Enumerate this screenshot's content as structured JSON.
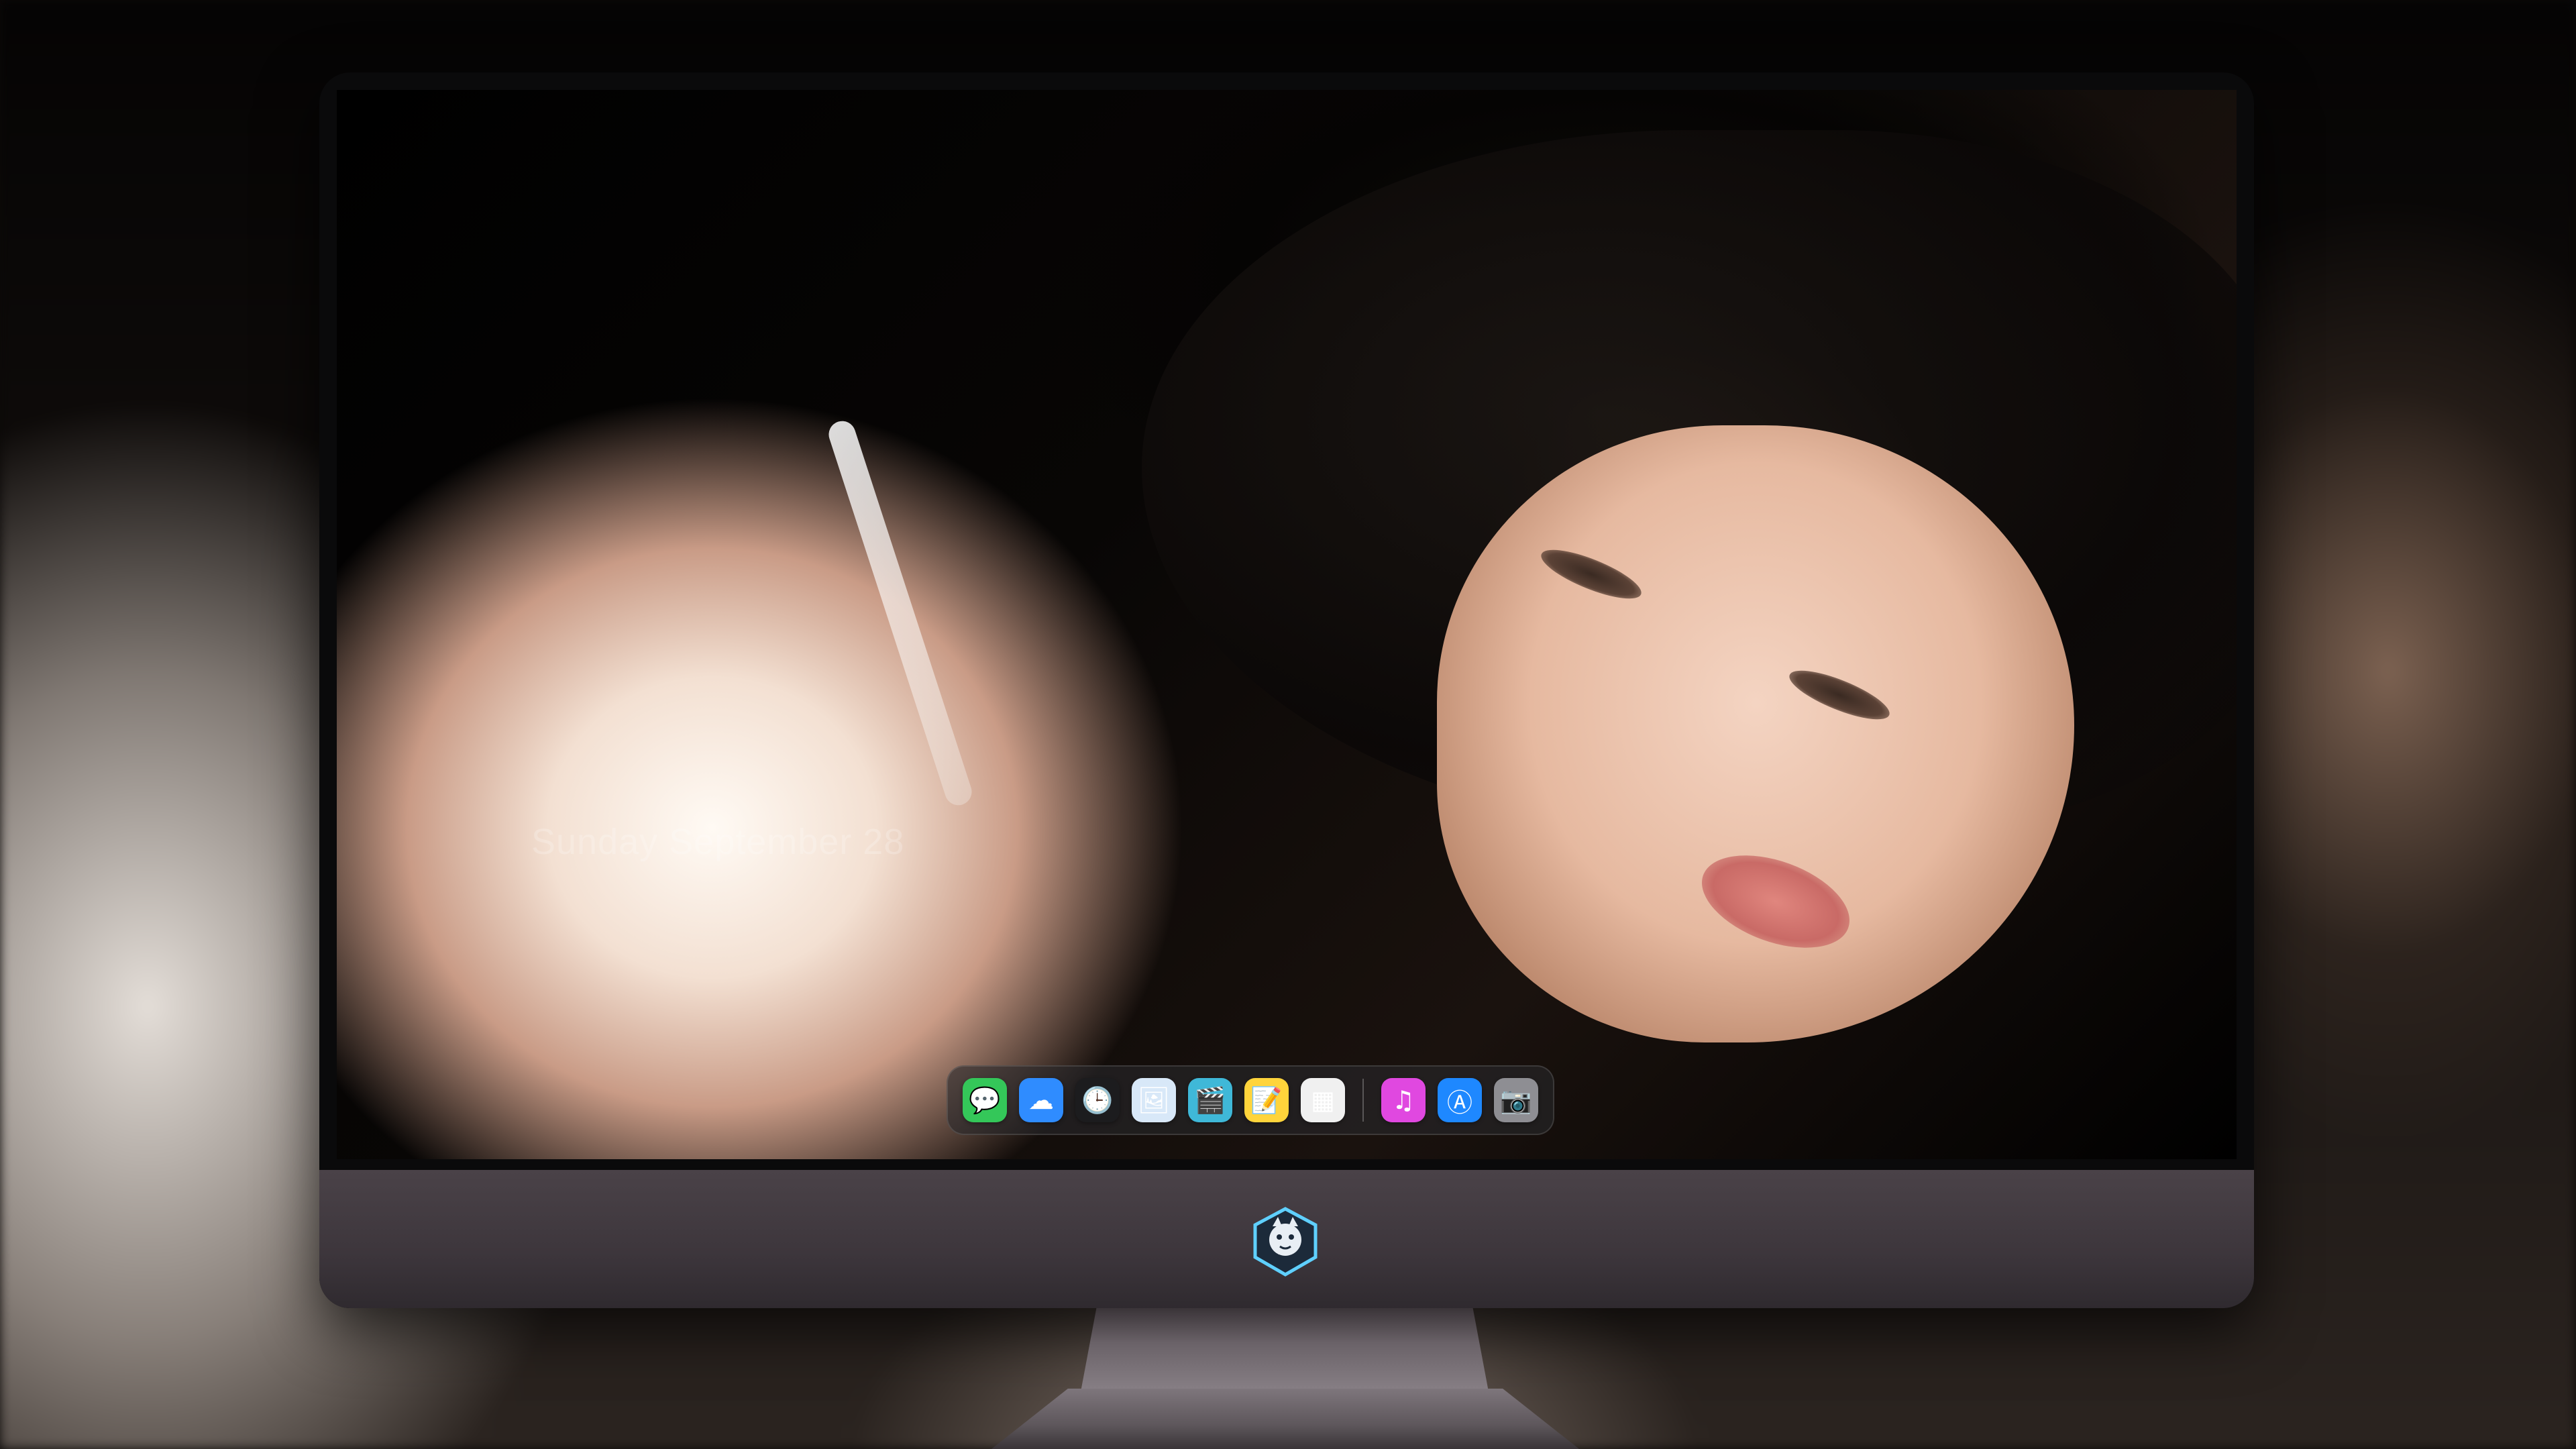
{
  "lockscreen": {
    "date": "Sunday September 28",
    "subtitle": ""
  },
  "dock": {
    "items": [
      {
        "name": "messages-icon",
        "label": "Messages",
        "glyph": "💬",
        "color": "#34c759"
      },
      {
        "name": "weather-icon",
        "label": "Weather",
        "glyph": "☁",
        "color": "#2f8cff"
      },
      {
        "name": "clock-icon",
        "label": "Clock",
        "glyph": "🕒",
        "color": "#1c1c1e"
      },
      {
        "name": "preview-icon",
        "label": "Preview",
        "glyph": "🖼",
        "color": "#d8e8f8"
      },
      {
        "name": "clips-icon",
        "label": "Clips",
        "glyph": "🎬",
        "color": "#3fb8d8"
      },
      {
        "name": "notes-icon",
        "label": "Notes",
        "glyph": "📝",
        "color": "#ffd43b"
      },
      {
        "name": "photo-collage-icon",
        "label": "Photos",
        "glyph": "▦",
        "color": "#f0f0f0"
      },
      {
        "name": "music-icon",
        "label": "Music",
        "glyph": "♫",
        "color": "#e048e0"
      },
      {
        "name": "app-store-icon",
        "label": "App Store",
        "glyph": "Ⓐ",
        "color": "#1e88ff"
      },
      {
        "name": "camera-icon",
        "label": "Camera",
        "glyph": "📷",
        "color": "#8e8e93"
      }
    ]
  },
  "chin": {
    "logo": "shield-mascot-logo"
  }
}
